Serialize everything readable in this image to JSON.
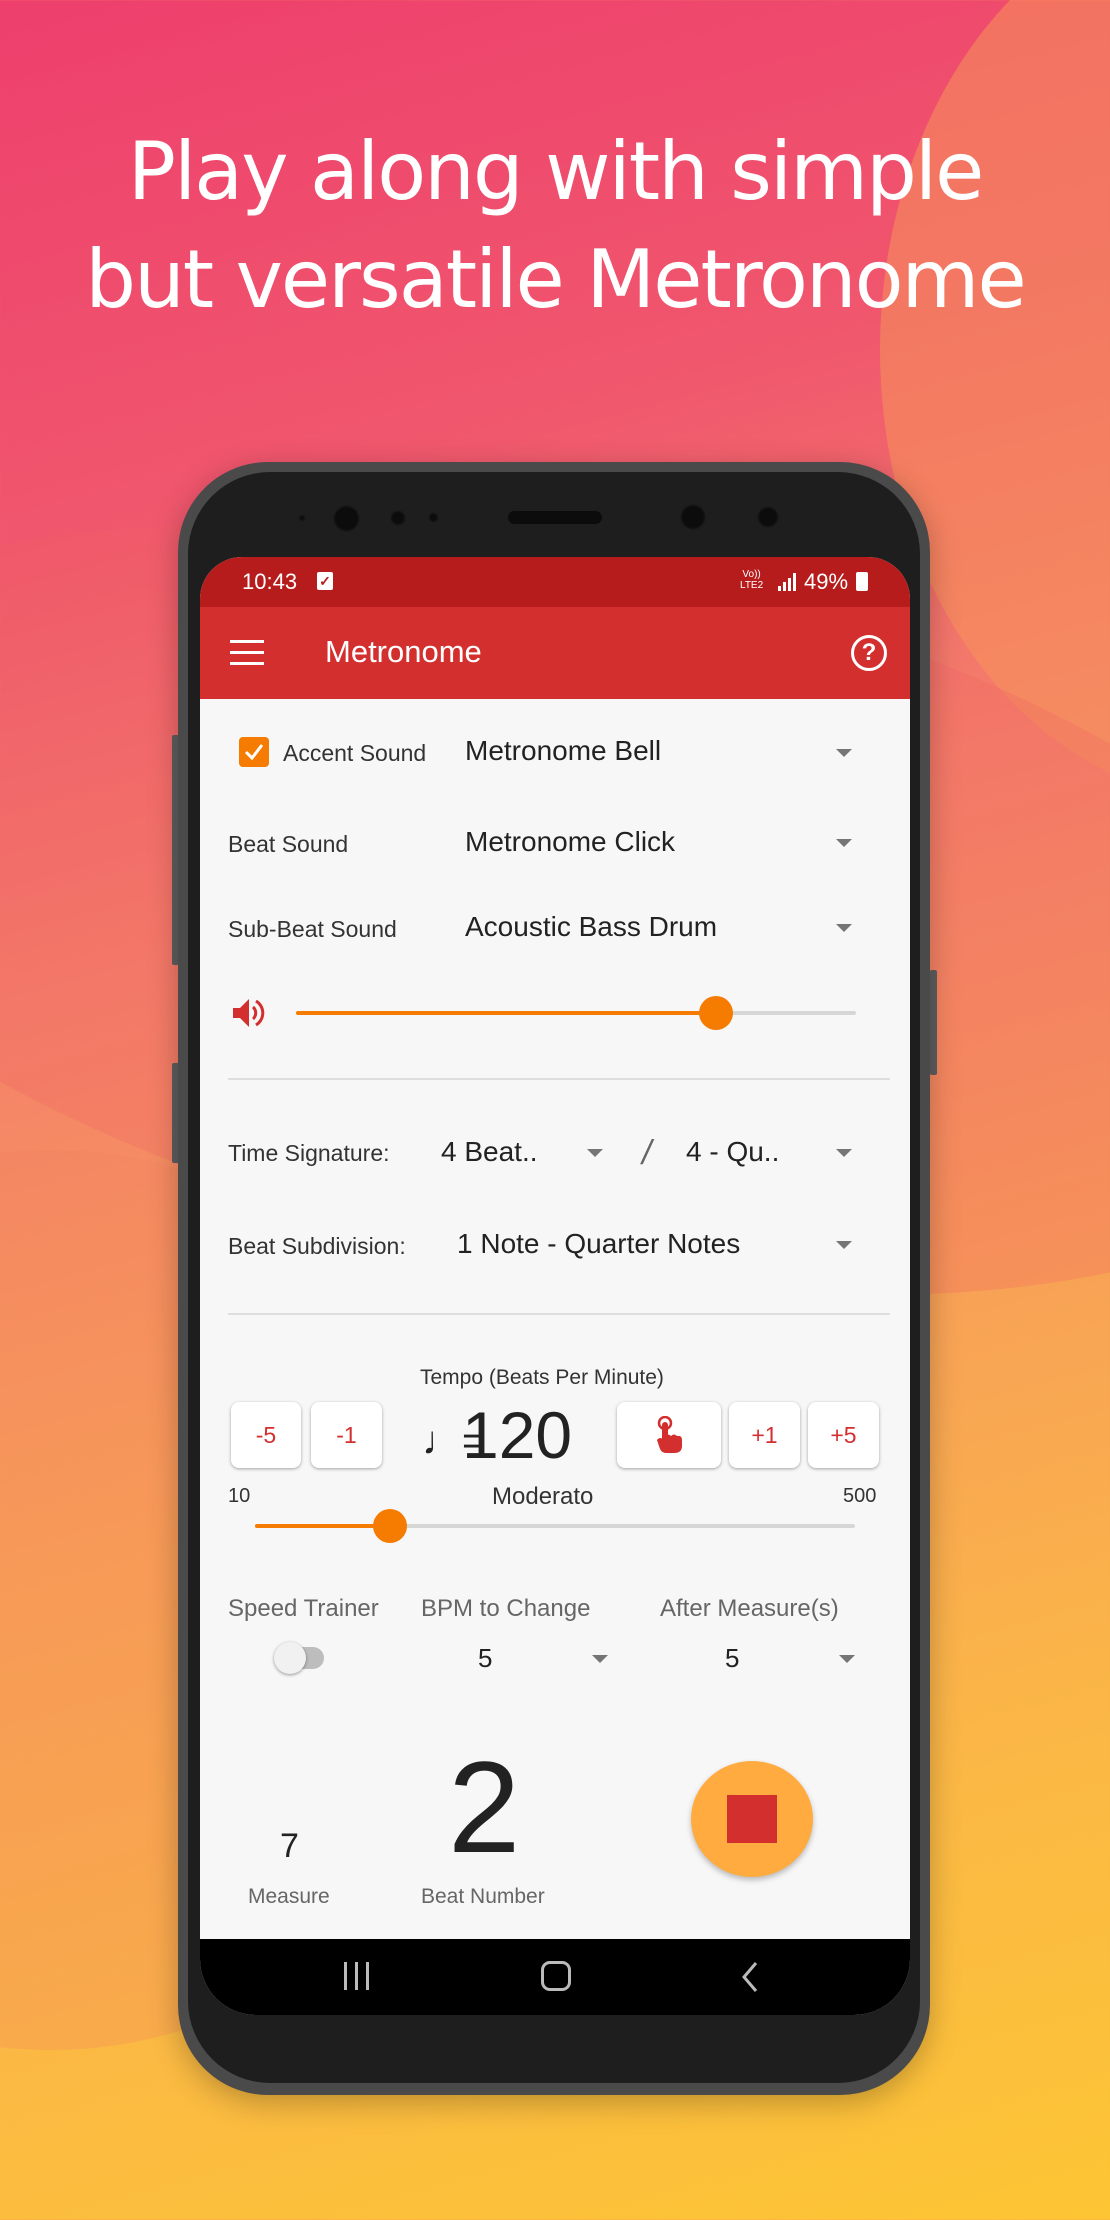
{
  "headline": {
    "line1": "Play along with simple",
    "line2": "but versatile Metronome"
  },
  "status_bar": {
    "time": "10:43",
    "notification_icon": "checkbox-notification-icon",
    "network_top": "Vo))",
    "network_bottom": "LTE2",
    "signal_icon": "signal-bars-icon",
    "battery_percent": "49%",
    "battery_icon": "battery-charging-icon"
  },
  "app_bar": {
    "menu_icon": "hamburger-menu-icon",
    "title": "Metronome",
    "help_icon": "help-circle-icon"
  },
  "sounds": {
    "accent": {
      "label": "Accent Sound",
      "checked": true,
      "value": "Metronome Bell"
    },
    "beat": {
      "label": "Beat Sound",
      "value": "Metronome Click"
    },
    "sub_beat": {
      "label": "Sub-Beat Sound",
      "value": "Acoustic Bass Drum"
    }
  },
  "volume": {
    "icon": "speaker-volume-icon",
    "level": 0.75
  },
  "time_signature": {
    "label": "Time Signature:",
    "beats_value": "4 Beat..",
    "separator": "/",
    "note_value": "4 - Qu.."
  },
  "subdivision": {
    "label": "Beat Subdivision:",
    "value": "1 Note - Quarter Notes"
  },
  "tempo": {
    "label": "Tempo (Beats Per Minute)",
    "note_symbol": "♩=",
    "bpm": 120,
    "bpm_display": "120",
    "min": 10,
    "max": 500,
    "min_label": "10",
    "max_label": "500",
    "marking": "Moderato",
    "buttons": {
      "minus5": "-5",
      "minus1": "-1",
      "tap_icon": "tap-finger-icon",
      "plus1": "+1",
      "plus5": "+5"
    }
  },
  "speed_trainer": {
    "label": "Speed Trainer",
    "enabled": false,
    "bpm_change_label": "BPM to Change",
    "bpm_change_value": "5",
    "after_measures_label": "After Measure(s)",
    "after_measures_value": "5"
  },
  "playback": {
    "measure_value": "7",
    "measure_label": "Measure",
    "beat_value": "2",
    "beat_label": "Beat Number",
    "button_icon": "stop-icon",
    "playing": true
  },
  "nav_bar": {
    "recent_icon": "recent-apps-icon",
    "home_icon": "home-icon",
    "back_icon": "back-icon"
  },
  "colors": {
    "primary": "#d32f2f",
    "primary_dark": "#b71c1c",
    "accent": "#f57c00",
    "play_button": "#ffab40"
  }
}
